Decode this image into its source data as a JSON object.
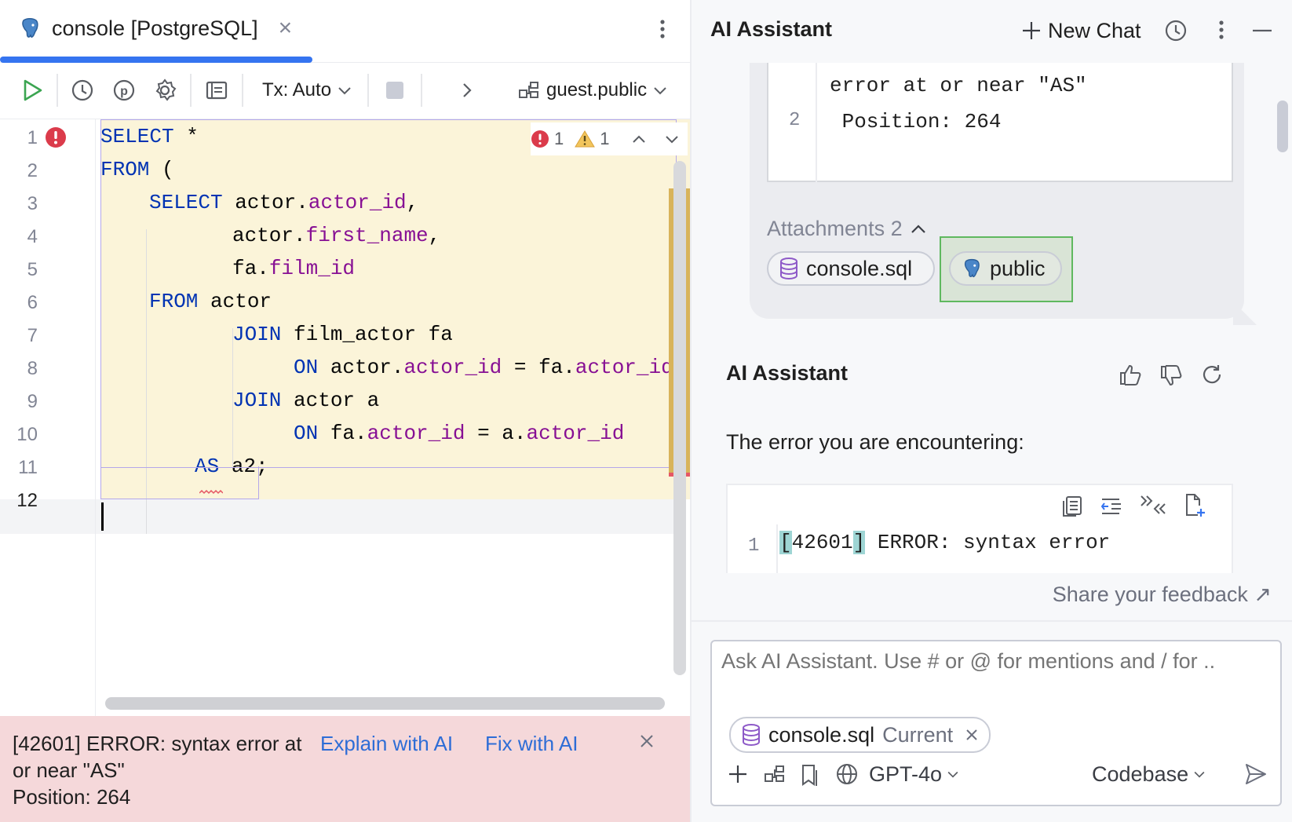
{
  "editor": {
    "tab": {
      "title": "console [PostgreSQL]",
      "close_icon": "×"
    },
    "toolbar": {
      "tx_mode": "Tx: Auto",
      "schema": "guest.public"
    },
    "inspections": {
      "errors": "1",
      "warnings": "1"
    },
    "line_numbers": [
      "1",
      "2",
      "3",
      "4",
      "5",
      "6",
      "7",
      "8",
      "9",
      "10",
      "11",
      "12"
    ],
    "code": [
      {
        "indent": 0,
        "tokens": [
          {
            "t": "SELECT",
            "c": "kw"
          },
          {
            "t": " *",
            "c": ""
          }
        ]
      },
      {
        "indent": 0,
        "tokens": [
          {
            "t": "FROM",
            "c": "kw"
          },
          {
            "t": " (",
            "c": ""
          }
        ]
      },
      {
        "indent": 1,
        "tokens": [
          {
            "t": "SELECT",
            "c": "kw"
          },
          {
            "t": " actor.",
            "c": ""
          },
          {
            "t": "actor_id",
            "c": "fld"
          },
          {
            "t": ",",
            "c": ""
          }
        ]
      },
      {
        "indent": 2,
        "tokens": [
          {
            "t": "actor.",
            "c": ""
          },
          {
            "t": "first_name",
            "c": "fld"
          },
          {
            "t": ",",
            "c": ""
          }
        ]
      },
      {
        "indent": 2,
        "tokens": [
          {
            "t": "fa.",
            "c": ""
          },
          {
            "t": "film_id",
            "c": "fld"
          }
        ]
      },
      {
        "indent": 1,
        "tokens": [
          {
            "t": "FROM",
            "c": "kw"
          },
          {
            "t": " actor",
            "c": ""
          }
        ]
      },
      {
        "indent": 2,
        "tokens": [
          {
            "t": "JOIN",
            "c": "kw"
          },
          {
            "t": " film_actor fa",
            "c": ""
          }
        ]
      },
      {
        "indent": 3,
        "tokens": [
          {
            "t": "ON",
            "c": "kw"
          },
          {
            "t": " actor.",
            "c": ""
          },
          {
            "t": "actor_id",
            "c": "fld"
          },
          {
            "t": " = fa.",
            "c": ""
          },
          {
            "t": "actor_id",
            "c": "fld"
          }
        ]
      },
      {
        "indent": 2,
        "tokens": [
          {
            "t": "JOIN",
            "c": "kw"
          },
          {
            "t": " actor a",
            "c": ""
          }
        ]
      },
      {
        "indent": 3,
        "tokens": [
          {
            "t": "ON",
            "c": "kw"
          },
          {
            "t": " fa.",
            "c": ""
          },
          {
            "t": "actor_id",
            "c": "fld"
          },
          {
            "t": " = a.",
            "c": ""
          },
          {
            "t": "actor_id",
            "c": "fld"
          }
        ]
      },
      {
        "indent": 4,
        "tokens": [
          {
            "t": "AS",
            "c": "kw"
          },
          {
            "t": " a2;",
            "c": ""
          }
        ]
      },
      {
        "indent": 0,
        "tokens": []
      }
    ],
    "error_banner": {
      "message": "[42601] ERROR: syntax error at or near \"AS\"",
      "position": "Position: 264",
      "explain_label": "Explain with AI",
      "fix_label": "Fix with AI"
    }
  },
  "assistant": {
    "title": "AI Assistant",
    "new_chat_label": "New Chat",
    "prev_message": {
      "code_line_1": "error at or near \"AS\"",
      "code_line_2_num": "2",
      "code_line_2": " Position: 264",
      "attachments_label": "Attachments 2",
      "attachments": [
        "console.sql",
        "public"
      ]
    },
    "reply": {
      "author": "AI Assistant",
      "text": "The error you are encountering:",
      "code_line_num": "1",
      "code_bracket_open": "[",
      "code_code": "42601",
      "code_bracket_close": "]",
      "code_rest": " ERROR: syntax error"
    },
    "feedback_label": "Share your feedback ↗",
    "input": {
      "placeholder": "Ask AI Assistant. Use # or @ for mentions and / for ..",
      "context_file": "console.sql",
      "context_tag": "Current",
      "model": "GPT-4o",
      "mode": "Codebase"
    }
  },
  "colors": {
    "accent": "#3574f0",
    "error_bg": "#f5d8da",
    "highlight_bg": "#fbf4d9",
    "keyword": "#0033b3",
    "field": "#871094"
  }
}
